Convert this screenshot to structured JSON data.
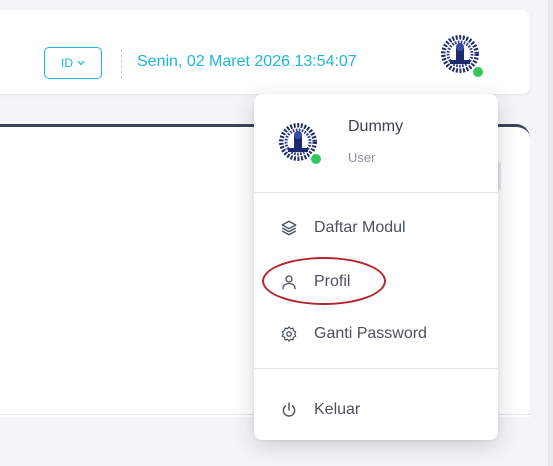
{
  "header": {
    "language_label": "ID",
    "datetime": "Senin, 02 Maret 2026 13:54:07"
  },
  "user_menu": {
    "name": "Dummy",
    "role": "User",
    "items": [
      {
        "label": "Daftar Modul",
        "icon": "layers-icon"
      },
      {
        "label": "Profil",
        "icon": "user-icon"
      },
      {
        "label": "Ganti Password",
        "icon": "gear-icon"
      },
      {
        "label": "Keluar",
        "icon": "power-icon"
      }
    ]
  },
  "colors": {
    "accent": "#1fb6d9",
    "online": "#34c759",
    "highlight": "#b3262f"
  }
}
